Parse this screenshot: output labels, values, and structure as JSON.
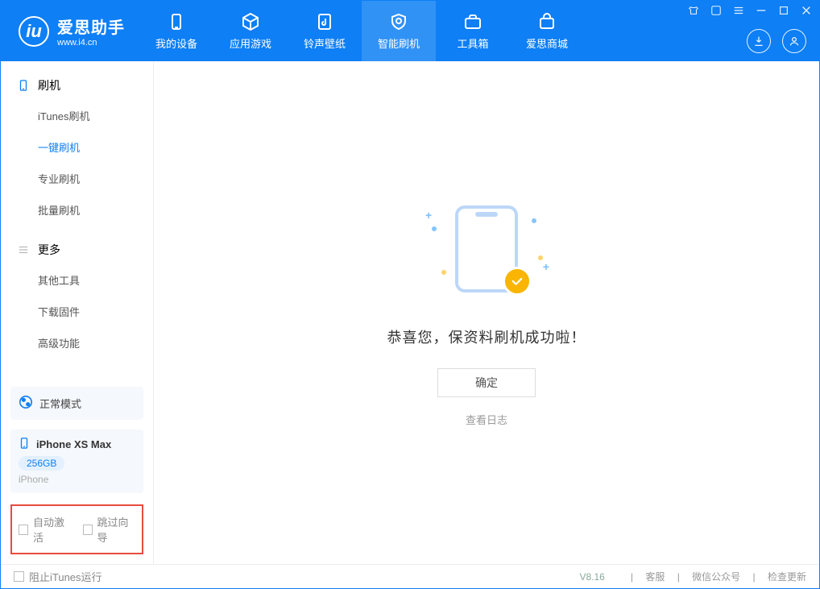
{
  "app": {
    "title": "爱思助手",
    "site": "www.i4.cn"
  },
  "nav": {
    "items": [
      {
        "label": "我的设备"
      },
      {
        "label": "应用游戏"
      },
      {
        "label": "铃声壁纸"
      },
      {
        "label": "智能刷机"
      },
      {
        "label": "工具箱"
      },
      {
        "label": "爱思商城"
      }
    ]
  },
  "sidebar": {
    "section1_title": "刷机",
    "section1_items": [
      "iTunes刷机",
      "一键刷机",
      "专业刷机",
      "批量刷机"
    ],
    "section2_title": "更多",
    "section2_items": [
      "其他工具",
      "下载固件",
      "高级功能"
    ]
  },
  "mode": {
    "label": "正常模式"
  },
  "device": {
    "name": "iPhone XS Max",
    "capacity": "256GB",
    "model": "iPhone"
  },
  "highlight": {
    "chk1": "自动激活",
    "chk2": "跳过向导"
  },
  "main": {
    "message": "恭喜您，保资料刷机成功啦！",
    "ok_label": "确定",
    "log_link": "查看日志"
  },
  "footer": {
    "block_itunes": "阻止iTunes运行",
    "version": "V8.16",
    "links": [
      "客服",
      "微信公众号",
      "检查更新"
    ]
  }
}
